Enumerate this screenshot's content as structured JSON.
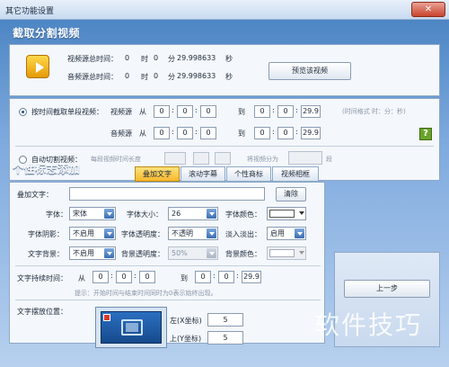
{
  "window": {
    "title": "其它功能设置",
    "close_glyph": "✕"
  },
  "section1": {
    "title": "截取分割视频",
    "video_duration_label": "视频源总时间：",
    "audio_duration_label": "音频源总时间：",
    "video_duration": {
      "h": "0",
      "h_unit": "时",
      "m": "0",
      "m_unit": "分",
      "s": "29.998633",
      "s_unit": "秒"
    },
    "audio_duration": {
      "h": "0",
      "h_unit": "时",
      "m": "0",
      "m_unit": "分",
      "s": "29.998633",
      "s_unit": "秒"
    },
    "preview_button": "预览该视频"
  },
  "cut_mode": {
    "single_label": "按时间截取单段视频：",
    "video_source_label": "视频源",
    "audio_source_label": "音频源",
    "from_label": "从",
    "to_label": "到",
    "time_hint": "(时间格式 时：分：秒)",
    "video_from": [
      "0",
      "0",
      "0"
    ],
    "video_to": [
      "0",
      "0",
      "29.9"
    ],
    "audio_from": [
      "0",
      "0",
      "0"
    ],
    "audio_to": [
      "0",
      "0",
      "29.9"
    ],
    "auto_label": "自动切割视频：",
    "each_length_label": "每段视频时间长度",
    "split_into_label": "将视频分为",
    "segments_unit": "段",
    "help_glyph": "?"
  },
  "section2": {
    "title": "个性标志添加",
    "tabs": [
      "叠加文字",
      "滚动字幕",
      "个性商标",
      "视频相框"
    ],
    "overlay_text_label": "叠加文字：",
    "clear_button": "清除",
    "font_label": "字体：",
    "font_value": "宋体",
    "font_size_label": "字体大小：",
    "font_size_value": "26",
    "font_color_label": "字体颜色：",
    "shadow_label": "字体阴影：",
    "shadow_value": "不启用",
    "font_opacity_label": "字体透明度：",
    "font_opacity_value": "不透明",
    "fade_label": "淡入淡出：",
    "fade_value": "启用",
    "text_bg_label": "文字背景：",
    "text_bg_value": "不启用",
    "bg_opacity_label": "背景透明度：",
    "bg_opacity_value": "50%",
    "bg_color_label": "背景颜色：",
    "duration_label": "文字持续时间：",
    "from_label": "从",
    "to_label": "到",
    "duration_from": [
      "0",
      "0",
      "0"
    ],
    "duration_to": [
      "0",
      "0",
      "29.9"
    ],
    "duration_hint": "提示：开始时间与结束时间同时为0表示始终出现。",
    "position_label": "文字摆放位置：",
    "left_label": "左(X坐标)",
    "left_value": "5",
    "top_label": "上(Y坐标)",
    "top_value": "5"
  },
  "nav": {
    "prev_button": "上一步"
  },
  "watermark": "软件技巧",
  "colors": {
    "accent": "#4d86c4",
    "tab_active": "#f6b72b",
    "help": "#6aa22a",
    "close": "#c8442e"
  }
}
